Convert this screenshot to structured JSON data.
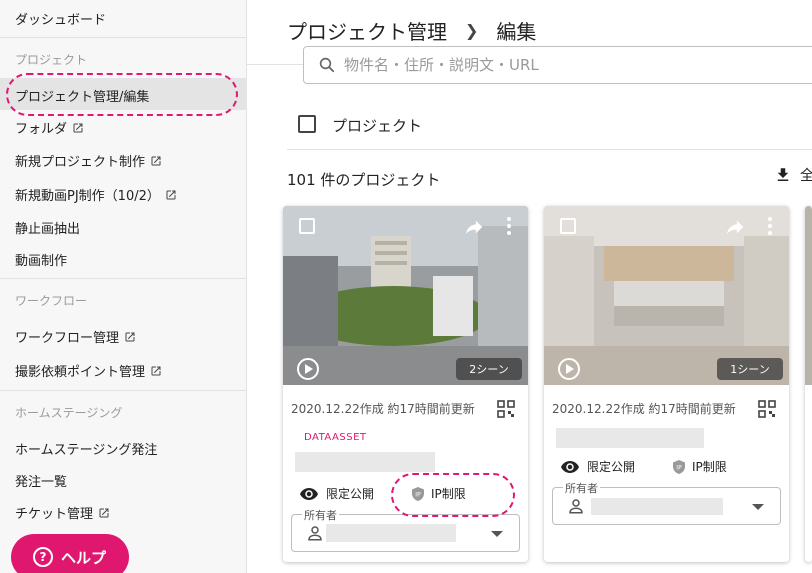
{
  "sidebar": {
    "dashboard": "ダッシュボード",
    "section_project": "プロジェクト",
    "project_manage": "プロジェクト管理/編集",
    "folder": "フォルダ",
    "new_project": "新規プロジェクト制作",
    "new_video": "新規動画PJ制作（10/2）",
    "still_extract": "静止画抽出",
    "video_make": "動画制作",
    "section_workflow": "ワークフロー",
    "workflow_manage": "ワークフロー管理",
    "shoot_points": "撮影依頼ポイント管理",
    "section_staging": "ホームステージング",
    "staging_order": "ホームステージング発注",
    "order_list": "発注一覧",
    "ticket_manage": "チケット管理",
    "help": "ヘルプ"
  },
  "header": {
    "crumb1": "プロジェクト管理",
    "crumb2": "編集"
  },
  "search": {
    "placeholder": "物件名・住所・説明文・URL"
  },
  "list": {
    "select_all_label": "プロジェクト",
    "count": "101 件のプロジェクト",
    "download_label": "全"
  },
  "cards": [
    {
      "scenes": "2シーン",
      "dates": "2020.12.22作成 約17時間前更新",
      "tag": "DATAASSET",
      "visibility": "限定公開",
      "ip": "IP制限",
      "owner_label": "所有者"
    },
    {
      "scenes": "1シーン",
      "dates": "2020.12.22作成 約17時間前更新",
      "visibility": "限定公開",
      "ip": "IP制限",
      "owner_label": "所有者"
    }
  ],
  "colors": {
    "accent": "#e0176f",
    "annotation": "#e01873"
  }
}
